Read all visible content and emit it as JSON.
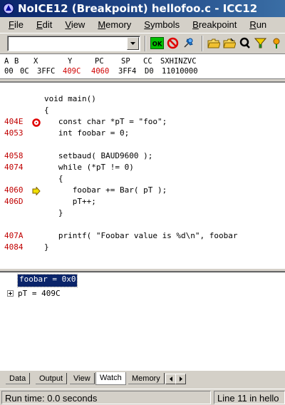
{
  "window": {
    "title": "NoICE12 (Breakpoint) hellofoo.c - ICC12"
  },
  "menu": [
    {
      "label": "File",
      "key": "F",
      "rest": "ile"
    },
    {
      "label": "Edit",
      "key": "E",
      "rest": "dit"
    },
    {
      "label": "View",
      "key": "V",
      "rest": "iew"
    },
    {
      "label": "Memory",
      "key": "M",
      "rest": "emory"
    },
    {
      "label": "Symbols",
      "key": "S",
      "rest": "ymbols"
    },
    {
      "label": "Breakpoint",
      "key": "B",
      "rest": "reakpoint"
    },
    {
      "label": "Run",
      "key": "R",
      "rest": "un"
    }
  ],
  "toolbar": {
    "symbol_combo_value": "",
    "ok_label": "OK",
    "buttons": [
      "ok-icon",
      "stop-icon",
      "pin-icon",
      "open-folder-icon",
      "open-folder-2-icon",
      "query-icon",
      "filter-icon",
      "flower-icon"
    ]
  },
  "registers": {
    "headers": [
      "A",
      "B",
      "X",
      "Y",
      "PC",
      "SP",
      "CC",
      "SXHINZVC"
    ],
    "values": [
      "00",
      "0C",
      "3FFC",
      "409C",
      "4060",
      "3FF4",
      "D0",
      "11010000"
    ],
    "changed_color": "#d00000"
  },
  "source": {
    "lines": [
      {
        "addr": "",
        "marker": "",
        "code": "void main()"
      },
      {
        "addr": "",
        "marker": "",
        "code": "{"
      },
      {
        "addr": "404E",
        "marker": "breakpoint",
        "code": "   const char *pT = \"foo\";"
      },
      {
        "addr": "4053",
        "marker": "",
        "code": "   int foobar = 0;"
      },
      {
        "addr": "",
        "marker": "",
        "code": ""
      },
      {
        "addr": "4058",
        "marker": "",
        "code": "   setbaud( BAUD9600 );"
      },
      {
        "addr": "4074",
        "marker": "",
        "code": "   while (*pT != 0)"
      },
      {
        "addr": "",
        "marker": "",
        "code": "   {"
      },
      {
        "addr": "4060",
        "marker": "current",
        "code": "      foobar += Bar( pT );"
      },
      {
        "addr": "406D",
        "marker": "",
        "code": "      pT++;"
      },
      {
        "addr": "",
        "marker": "",
        "code": "   }"
      },
      {
        "addr": "",
        "marker": "",
        "code": ""
      },
      {
        "addr": "407A",
        "marker": "",
        "code": "   printf( \"Foobar value is %d\\n\", foobar"
      },
      {
        "addr": "4084",
        "marker": "",
        "code": "}"
      }
    ]
  },
  "watch": {
    "items": [
      {
        "text": "foobar = 0x0",
        "selected": true,
        "expandable": false
      },
      {
        "text": "pT = 409C",
        "selected": false,
        "expandable": true
      }
    ]
  },
  "tabs": [
    {
      "label": "Data",
      "active": false
    },
    {
      "label": "Output",
      "active": false
    },
    {
      "label": "View",
      "active": false
    },
    {
      "label": "Watch",
      "active": true
    },
    {
      "label": "Memory",
      "active": false
    }
  ],
  "status": {
    "run_time": "Run time: 0.0 seconds",
    "location": "Line 11  in hello"
  },
  "colors": {
    "title_gradient_start": "#0a246a",
    "title_gradient_end": "#3a6ea5",
    "address_color": "#c00000",
    "selection_bg": "#0a246a"
  }
}
